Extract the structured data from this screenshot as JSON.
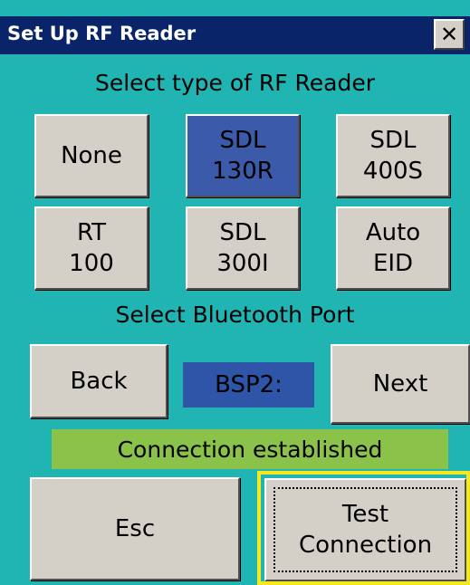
{
  "window": {
    "title": "Set Up RF Reader",
    "close_glyph": "✕"
  },
  "reader_section": {
    "label": "Select type of RF Reader",
    "options": [
      {
        "label": "None",
        "selected": false
      },
      {
        "label": "SDL\n130R",
        "selected": true
      },
      {
        "label": "SDL\n400S",
        "selected": false
      },
      {
        "label": "RT\n100",
        "selected": false
      },
      {
        "label": "SDL\n300I",
        "selected": false
      },
      {
        "label": "Auto\nEID",
        "selected": false
      }
    ]
  },
  "bluetooth_section": {
    "label": "Select Bluetooth Port",
    "back_label": "Back",
    "port_value": "BSP2:",
    "next_label": "Next"
  },
  "status": {
    "text": "Connection established"
  },
  "actions": {
    "esc_label": "Esc",
    "test_label": "Test\nConnection"
  },
  "colors": {
    "background": "#20b4b2",
    "titlebar": "#0a246a",
    "selected_button": "#3c5aaa",
    "status_bar": "#8bc34a",
    "focus_frame": "#f5e81c"
  }
}
